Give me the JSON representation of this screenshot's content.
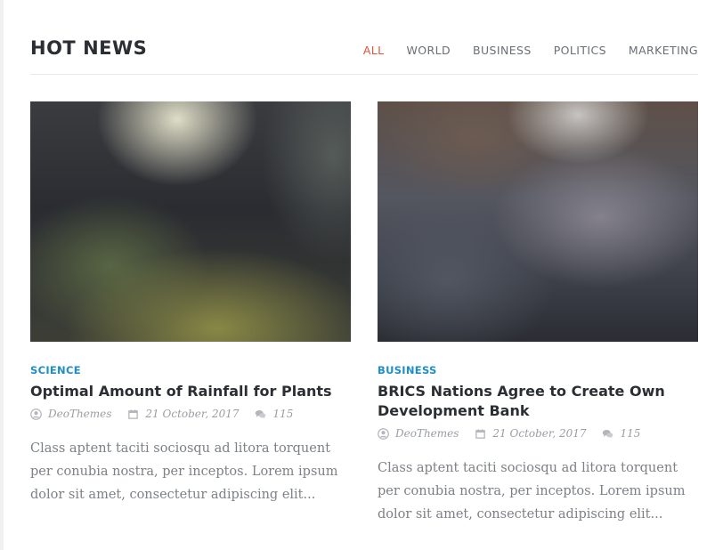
{
  "section": {
    "title": "HOT NEWS",
    "filters": [
      "ALL",
      "WORLD",
      "BUSINESS",
      "POLITICS",
      "MARKETING"
    ],
    "active_filter": "ALL"
  },
  "articles": [
    {
      "category": "SCIENCE",
      "title": "Optimal Amount of Rainfall for Plants",
      "author": "DeoThemes",
      "date": "21 October, 2017",
      "comments": "115",
      "excerpt": "Class aptent taciti sociosqu ad litora torquent per conubia nostra, per inceptos. Lorem ipsum dolor sit amet, consectetur adipiscing elit..."
    },
    {
      "category": "BUSINESS",
      "title": "BRICS Nations Agree to Create Own Development Bank",
      "author": "DeoThemes",
      "date": "21 October, 2017",
      "comments": "115",
      "excerpt": "Class aptent taciti sociosqu ad litora torquent per conubia nostra, per inceptos. Lorem ipsum dolor sit amet, consectetur adipiscing elit..."
    }
  ],
  "colors": {
    "accent": "#e2553a",
    "category": "#1f8ec7",
    "heading": "#2b2e33",
    "meta": "#9a9ea3"
  },
  "icons": {
    "author": "user-icon",
    "date": "calendar-icon",
    "comments": "comments-icon"
  }
}
